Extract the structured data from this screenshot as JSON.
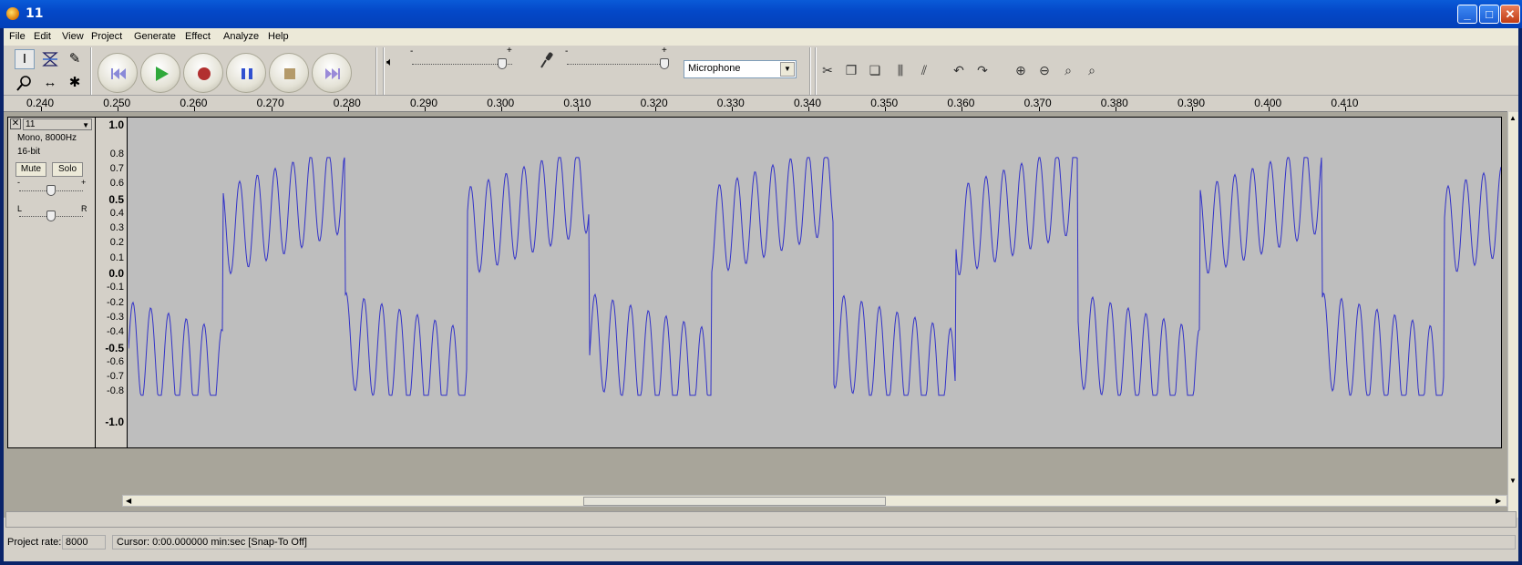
{
  "window": {
    "title": "11",
    "controls": [
      "minimize",
      "maximize",
      "close"
    ]
  },
  "menu": [
    {
      "label": "File",
      "key": "F"
    },
    {
      "label": "Edit",
      "key": "E"
    },
    {
      "label": "View",
      "key": "V"
    },
    {
      "label": "Project",
      "key": "P"
    },
    {
      "label": "Generate",
      "key": "G"
    },
    {
      "label": "Effect",
      "key": "c"
    },
    {
      "label": "Analyze",
      "key": "A"
    },
    {
      "label": "Help",
      "key": "H"
    }
  ],
  "tools": [
    "selection-tool-icon",
    "envelope-tool-icon",
    "draw-tool-icon",
    "zoom-tool-icon",
    "timeshift-tool-icon",
    "multi-tool-icon"
  ],
  "transport": [
    "skip-start",
    "play",
    "record",
    "pause",
    "stop",
    "skip-end"
  ],
  "mixer": {
    "output_volume": 0.9,
    "input_volume": 0.97,
    "input_source": "Microphone"
  },
  "ruler": {
    "ticks": [
      "0.240",
      "0.250",
      "0.260",
      "0.270",
      "0.280",
      "0.290",
      "0.300",
      "0.310",
      "0.320",
      "0.330",
      "0.340",
      "0.350",
      "0.360",
      "0.370",
      "0.380",
      "0.390",
      "0.400",
      "0.410"
    ]
  },
  "track": {
    "name": "11",
    "info_line1": "Mono, 8000Hz",
    "info_line2": "16-bit",
    "mute_label": "Mute",
    "solo_label": "Solo",
    "gain_minus": "-",
    "gain_plus": "+",
    "pan_left": "L",
    "pan_right": "R",
    "vruler": [
      "1.0",
      "0.8",
      "0.7",
      "0.6",
      "0.5",
      "0.4",
      "0.3",
      "0.2",
      "0.1",
      "0.0",
      "-0.1",
      "-0.2",
      "-0.3",
      "-0.4",
      "-0.5",
      "-0.6",
      "-0.7",
      "-0.8",
      "-1.0"
    ],
    "waveform_color": "#3232c8"
  },
  "status": {
    "rate_label": "Project rate:",
    "rate_value": "8000",
    "cursor_text": "Cursor: 0:00.000000 min:sec   [Snap-To Off]"
  },
  "colors": {
    "titlebar": "#0448c8",
    "track_bg": "#bebebe",
    "waveform": "#3232c8"
  }
}
